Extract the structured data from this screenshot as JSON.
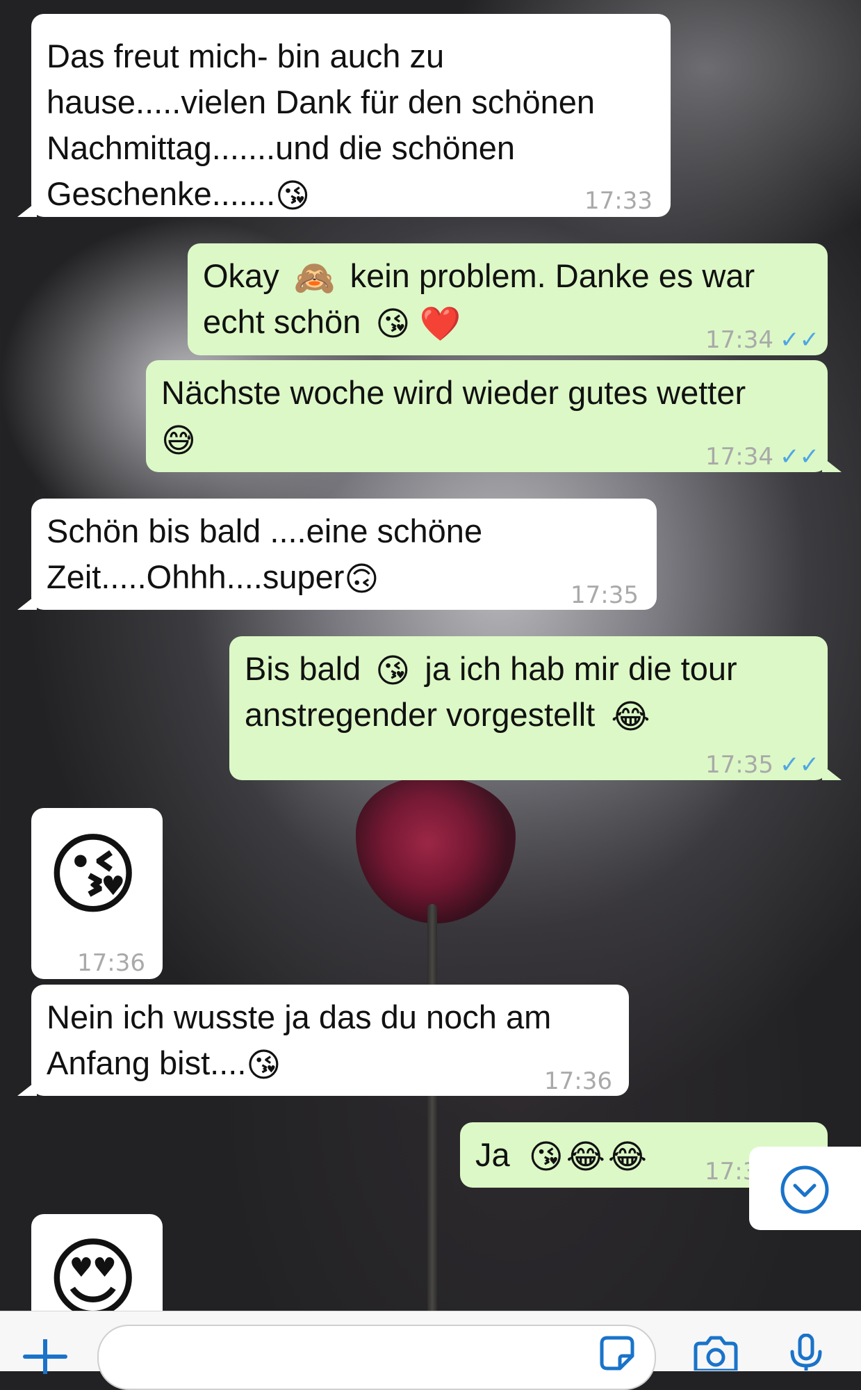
{
  "messages": [
    {
      "dir": "in",
      "lines": [
        "Das freut mich- bin auch zu",
        "hause.....vielen Dank für den schönen",
        "Nachmittag.......und die schönen",
        "Geschenke......."
      ],
      "emoji_end": "😘",
      "time": "17:33"
    },
    {
      "dir": "out",
      "lines": [
        "Okay",
        "kein problem. Danke es war",
        "echt schön"
      ],
      "emojis": [
        "🙈",
        "😘",
        "❤️"
      ],
      "time": "17:34",
      "ticks": "✓✓"
    },
    {
      "dir": "out",
      "lines": [
        "Nächste woche wird wieder gutes wetter"
      ],
      "emoji_end": "😅",
      "time": "17:34",
      "ticks": "✓✓"
    },
    {
      "dir": "in",
      "lines": [
        "Schön bis bald ....eine schöne",
        "Zeit.....Ohhh....super"
      ],
      "emoji_end": "🙃",
      "time": "17:35"
    },
    {
      "dir": "out",
      "lines": [
        "Bis bald",
        "ja ich hab mir die tour",
        "anstregender vorgestellt"
      ],
      "emojis": [
        "😘",
        "😂"
      ],
      "time": "17:35",
      "ticks": "✓✓"
    },
    {
      "dir": "in",
      "big_emoji": "😘",
      "time": "17:36"
    },
    {
      "dir": "in",
      "lines": [
        "Nein ich wusste ja das du noch am",
        "Anfang bist...."
      ],
      "emoji_end": "😘",
      "time": "17:36"
    },
    {
      "dir": "out",
      "lines": [
        "Ja"
      ],
      "emojis": [
        "😘",
        "😂",
        "😂"
      ],
      "time": "17:3"
    },
    {
      "dir": "in",
      "big_emoji": "😍"
    }
  ],
  "controls": {
    "plus_icon": "plus-icon",
    "sticker_icon": "sticker-icon",
    "camera_icon": "camera-icon",
    "mic_icon": "microphone-icon",
    "scroll_icon": "chevron-down-circle-icon"
  },
  "colors": {
    "incoming_bubble": "#ffffff",
    "outgoing_bubble": "#dcf8c6",
    "read_ticks": "#4fa6e3",
    "accent": "#1a73c9"
  }
}
